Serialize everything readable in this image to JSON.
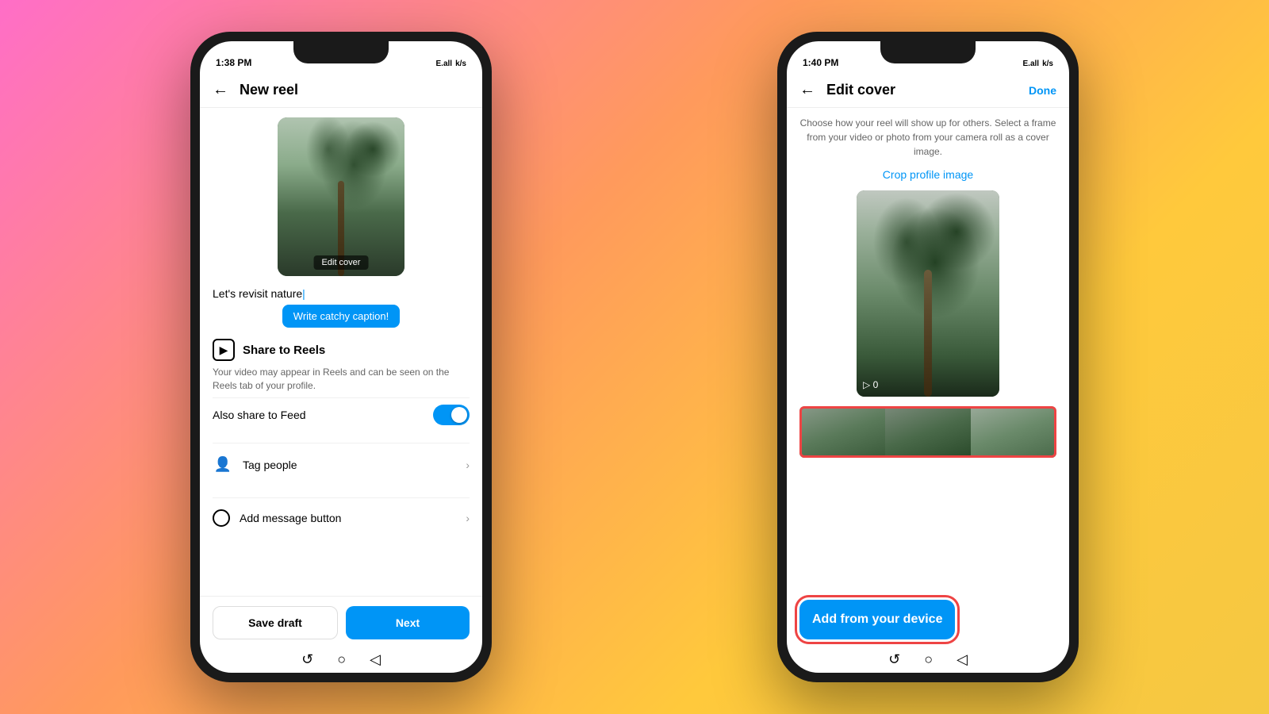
{
  "phone1": {
    "status": {
      "time": "1:38 PM",
      "signal": "E.all",
      "battery": "k/s"
    },
    "header": {
      "back_label": "←",
      "title": "New reel"
    },
    "video": {
      "edit_cover_label": "Edit cover"
    },
    "caption": {
      "text": "Let's revisit nature",
      "catchy_btn": "Write catchy caption!"
    },
    "share": {
      "title": "Share to Reels",
      "desc": "Your video may appear in Reels and can be seen on the Reels tab of your profile.",
      "feed_toggle_label": "Also share to Feed",
      "toggle_on": true
    },
    "menu_items": [
      {
        "id": "tag-people",
        "icon": "👤",
        "label": "Tag people"
      },
      {
        "id": "add-message",
        "icon": "○",
        "label": "Add message button"
      }
    ],
    "footer": {
      "save_draft": "Save draft",
      "next": "Next"
    },
    "nav": {
      "home": "⌂",
      "circle": "○",
      "back_nav": "←"
    }
  },
  "phone2": {
    "status": {
      "time": "1:40 PM",
      "signal": "E.all",
      "battery": "k/s"
    },
    "header": {
      "back_label": "←",
      "title": "Edit cover",
      "done": "Done"
    },
    "desc": "Choose how your reel will show up for others. Select a frame from your video or photo from your camera roll as a cover image.",
    "crop_link": "Crop profile image",
    "video": {
      "counter": "▷ 0"
    },
    "add_device_btn": "Add from your device",
    "nav": {
      "home": "⌂",
      "circle": "○",
      "back_nav": "←"
    }
  }
}
